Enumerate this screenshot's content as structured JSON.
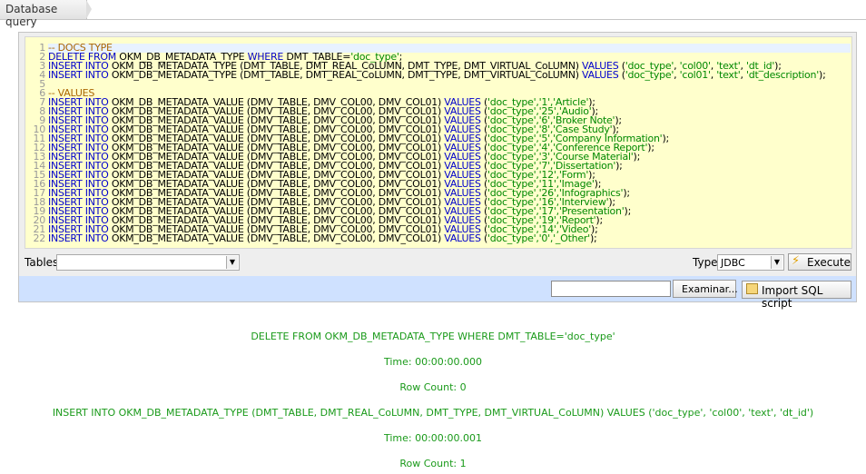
{
  "tab": {
    "title": "Database query"
  },
  "editor": {
    "line_numbers": [
      "1",
      "2",
      "3",
      "4",
      "5",
      "6",
      "7",
      "8",
      "9",
      "10",
      "11",
      "12",
      "13",
      "14",
      "15",
      "16",
      "17",
      "18",
      "19",
      "20",
      "21",
      "22"
    ],
    "lines": [
      [
        {
          "t": "cmt",
          "v": "-- DOCS TYPE"
        }
      ],
      [
        {
          "t": "kw",
          "v": "DELETE FROM "
        },
        {
          "t": "plain",
          "v": "OKM_DB_METADATA_TYPE "
        },
        {
          "t": "kw",
          "v": "WHERE "
        },
        {
          "t": "plain",
          "v": "DMT_TABLE="
        },
        {
          "t": "str",
          "v": "'doc_type'"
        },
        {
          "t": "plain",
          "v": ";"
        }
      ],
      [
        {
          "t": "kw",
          "v": "INSERT INTO "
        },
        {
          "t": "plain",
          "v": "OKM_DB_METADATA_TYPE (DMT_TABLE, DMT_REAL_CoLUMN, DMT_TYPE, DMT_VIRTUAL_CoLUMN) "
        },
        {
          "t": "kw",
          "v": "VALUES "
        },
        {
          "t": "plain",
          "v": "("
        },
        {
          "t": "str",
          "v": "'doc_type'"
        },
        {
          "t": "plain",
          "v": ", "
        },
        {
          "t": "str",
          "v": "'col00'"
        },
        {
          "t": "plain",
          "v": ", "
        },
        {
          "t": "str",
          "v": "'text'"
        },
        {
          "t": "plain",
          "v": ", "
        },
        {
          "t": "str",
          "v": "'dt_id'"
        },
        {
          "t": "plain",
          "v": ");"
        }
      ],
      [
        {
          "t": "kw",
          "v": "INSERT INTO "
        },
        {
          "t": "plain",
          "v": "OKM_DB_METADATA_TYPE (DMT_TABLE, DMT_REAL_CoLUMN, DMT_TYPE, DMT_VIRTUAL_CoLUMN) "
        },
        {
          "t": "kw",
          "v": "VALUES "
        },
        {
          "t": "plain",
          "v": "("
        },
        {
          "t": "str",
          "v": "'doc_type'"
        },
        {
          "t": "plain",
          "v": ", "
        },
        {
          "t": "str",
          "v": "'col01'"
        },
        {
          "t": "plain",
          "v": ", "
        },
        {
          "t": "str",
          "v": "'text'"
        },
        {
          "t": "plain",
          "v": ", "
        },
        {
          "t": "str",
          "v": "'dt_description'"
        },
        {
          "t": "plain",
          "v": ");"
        }
      ],
      [],
      [
        {
          "t": "cmt",
          "v": "-- VALUES"
        }
      ],
      [
        {
          "t": "kw",
          "v": "INSERT INTO "
        },
        {
          "t": "plain",
          "v": "OKM_DB_METADATA_VALUE (DMV_TABLE, DMV_COL00, DMV_COL01) "
        },
        {
          "t": "kw",
          "v": "VALUES "
        },
        {
          "t": "plain",
          "v": "("
        },
        {
          "t": "str",
          "v": "'doc_type','1','Article'"
        },
        {
          "t": "plain",
          "v": ");"
        }
      ],
      [
        {
          "t": "kw",
          "v": "INSERT INTO "
        },
        {
          "t": "plain",
          "v": "OKM_DB_METADATA_VALUE (DMV_TABLE, DMV_COL00, DMV_COL01) "
        },
        {
          "t": "kw",
          "v": "VALUES "
        },
        {
          "t": "plain",
          "v": "("
        },
        {
          "t": "str",
          "v": "'doc_type','25','Audio'"
        },
        {
          "t": "plain",
          "v": ");"
        }
      ],
      [
        {
          "t": "kw",
          "v": "INSERT INTO "
        },
        {
          "t": "plain",
          "v": "OKM_DB_METADATA_VALUE (DMV_TABLE, DMV_COL00, DMV_COL01) "
        },
        {
          "t": "kw",
          "v": "VALUES "
        },
        {
          "t": "plain",
          "v": "("
        },
        {
          "t": "str",
          "v": "'doc_type','6','Broker Note'"
        },
        {
          "t": "plain",
          "v": ");"
        }
      ],
      [
        {
          "t": "kw",
          "v": "INSERT INTO "
        },
        {
          "t": "plain",
          "v": "OKM_DB_METADATA_VALUE (DMV_TABLE, DMV_COL00, DMV_COL01) "
        },
        {
          "t": "kw",
          "v": "VALUES "
        },
        {
          "t": "plain",
          "v": "("
        },
        {
          "t": "str",
          "v": "'doc_type','8','Case Study'"
        },
        {
          "t": "plain",
          "v": ");"
        }
      ],
      [
        {
          "t": "kw",
          "v": "INSERT INTO "
        },
        {
          "t": "plain",
          "v": "OKM_DB_METADATA_VALUE (DMV_TABLE, DMV_COL00, DMV_COL01) "
        },
        {
          "t": "kw",
          "v": "VALUES "
        },
        {
          "t": "plain",
          "v": "("
        },
        {
          "t": "str",
          "v": "'doc_type','5','Company Information'"
        },
        {
          "t": "plain",
          "v": ");"
        }
      ],
      [
        {
          "t": "kw",
          "v": "INSERT INTO "
        },
        {
          "t": "plain",
          "v": "OKM_DB_METADATA_VALUE (DMV_TABLE, DMV_COL00, DMV_COL01) "
        },
        {
          "t": "kw",
          "v": "VALUES "
        },
        {
          "t": "plain",
          "v": "("
        },
        {
          "t": "str",
          "v": "'doc_type','4','Conference Report'"
        },
        {
          "t": "plain",
          "v": ");"
        }
      ],
      [
        {
          "t": "kw",
          "v": "INSERT INTO "
        },
        {
          "t": "plain",
          "v": "OKM_DB_METADATA_VALUE (DMV_TABLE, DMV_COL00, DMV_COL01) "
        },
        {
          "t": "kw",
          "v": "VALUES "
        },
        {
          "t": "plain",
          "v": "("
        },
        {
          "t": "str",
          "v": "'doc_type','3','Course Material'"
        },
        {
          "t": "plain",
          "v": ");"
        }
      ],
      [
        {
          "t": "kw",
          "v": "INSERT INTO "
        },
        {
          "t": "plain",
          "v": "OKM_DB_METADATA_VALUE (DMV_TABLE, DMV_COL00, DMV_COL01) "
        },
        {
          "t": "kw",
          "v": "VALUES "
        },
        {
          "t": "plain",
          "v": "("
        },
        {
          "t": "str",
          "v": "'doc_type','7','Dissertation'"
        },
        {
          "t": "plain",
          "v": ");"
        }
      ],
      [
        {
          "t": "kw",
          "v": "INSERT INTO "
        },
        {
          "t": "plain",
          "v": "OKM_DB_METADATA_VALUE (DMV_TABLE, DMV_COL00, DMV_COL01) "
        },
        {
          "t": "kw",
          "v": "VALUES "
        },
        {
          "t": "plain",
          "v": "("
        },
        {
          "t": "str",
          "v": "'doc_type','12','Form'"
        },
        {
          "t": "plain",
          "v": ");"
        }
      ],
      [
        {
          "t": "kw",
          "v": "INSERT INTO "
        },
        {
          "t": "plain",
          "v": "OKM_DB_METADATA_VALUE (DMV_TABLE, DMV_COL00, DMV_COL01) "
        },
        {
          "t": "kw",
          "v": "VALUES "
        },
        {
          "t": "plain",
          "v": "("
        },
        {
          "t": "str",
          "v": "'doc_type','11','Image'"
        },
        {
          "t": "plain",
          "v": ");"
        }
      ],
      [
        {
          "t": "kw",
          "v": "INSERT INTO "
        },
        {
          "t": "plain",
          "v": "OKM_DB_METADATA_VALUE (DMV_TABLE, DMV_COL00, DMV_COL01) "
        },
        {
          "t": "kw",
          "v": "VALUES "
        },
        {
          "t": "plain",
          "v": "("
        },
        {
          "t": "str",
          "v": "'doc_type','26','Infographics'"
        },
        {
          "t": "plain",
          "v": ");"
        }
      ],
      [
        {
          "t": "kw",
          "v": "INSERT INTO "
        },
        {
          "t": "plain",
          "v": "OKM_DB_METADATA_VALUE (DMV_TABLE, DMV_COL00, DMV_COL01) "
        },
        {
          "t": "kw",
          "v": "VALUES "
        },
        {
          "t": "plain",
          "v": "("
        },
        {
          "t": "str",
          "v": "'doc_type','16','Interview'"
        },
        {
          "t": "plain",
          "v": ");"
        }
      ],
      [
        {
          "t": "kw",
          "v": "INSERT INTO "
        },
        {
          "t": "plain",
          "v": "OKM_DB_METADATA_VALUE (DMV_TABLE, DMV_COL00, DMV_COL01) "
        },
        {
          "t": "kw",
          "v": "VALUES "
        },
        {
          "t": "plain",
          "v": "("
        },
        {
          "t": "str",
          "v": "'doc_type','17','Presentation'"
        },
        {
          "t": "plain",
          "v": ");"
        }
      ],
      [
        {
          "t": "kw",
          "v": "INSERT INTO "
        },
        {
          "t": "plain",
          "v": "OKM_DB_METADATA_VALUE (DMV_TABLE, DMV_COL00, DMV_COL01) "
        },
        {
          "t": "kw",
          "v": "VALUES "
        },
        {
          "t": "plain",
          "v": "("
        },
        {
          "t": "str",
          "v": "'doc_type','19','Report'"
        },
        {
          "t": "plain",
          "v": ");"
        }
      ],
      [
        {
          "t": "kw",
          "v": "INSERT INTO "
        },
        {
          "t": "plain",
          "v": "OKM_DB_METADATA_VALUE (DMV_TABLE, DMV_COL00, DMV_COL01) "
        },
        {
          "t": "kw",
          "v": "VALUES "
        },
        {
          "t": "plain",
          "v": "("
        },
        {
          "t": "str",
          "v": "'doc_type','14','Video'"
        },
        {
          "t": "plain",
          "v": ");"
        }
      ],
      [
        {
          "t": "kw",
          "v": "INSERT INTO "
        },
        {
          "t": "plain",
          "v": "OKM_DB_METADATA_VALUE (DMV_TABLE, DMV_COL00, DMV_COL01) "
        },
        {
          "t": "kw",
          "v": "VALUES "
        },
        {
          "t": "plain",
          "v": "("
        },
        {
          "t": "str",
          "v": "'doc_type','0','_Other'"
        },
        {
          "t": "plain",
          "v": ");"
        }
      ]
    ]
  },
  "toolbar": {
    "tables_label": "Tables",
    "tables_value": "",
    "type_label": "Type",
    "type_value": "JDBC",
    "execute_label": "Execute"
  },
  "import": {
    "file_value": "",
    "browse_label": "Examinar...",
    "import_label": "Import SQL script"
  },
  "results": [
    "DELETE FROM OKM_DB_METADATA_TYPE WHERE DMT_TABLE='doc_type'",
    "Time: 00:00:00.000",
    "Row Count: 0",
    "INSERT INTO OKM_DB_METADATA_TYPE (DMT_TABLE, DMT_REAL_CoLUMN, DMT_TYPE, DMT_VIRTUAL_CoLUMN) VALUES ('doc_type', 'col00', 'text', 'dt_id')",
    "Time: 00:00:00.001",
    "Row Count: 1"
  ],
  "colors": {
    "editor_bg": "#ffffcc",
    "keyword": "#0000cc",
    "string": "#008800",
    "comment": "#aa6600",
    "result_text": "#1a9a1a"
  }
}
